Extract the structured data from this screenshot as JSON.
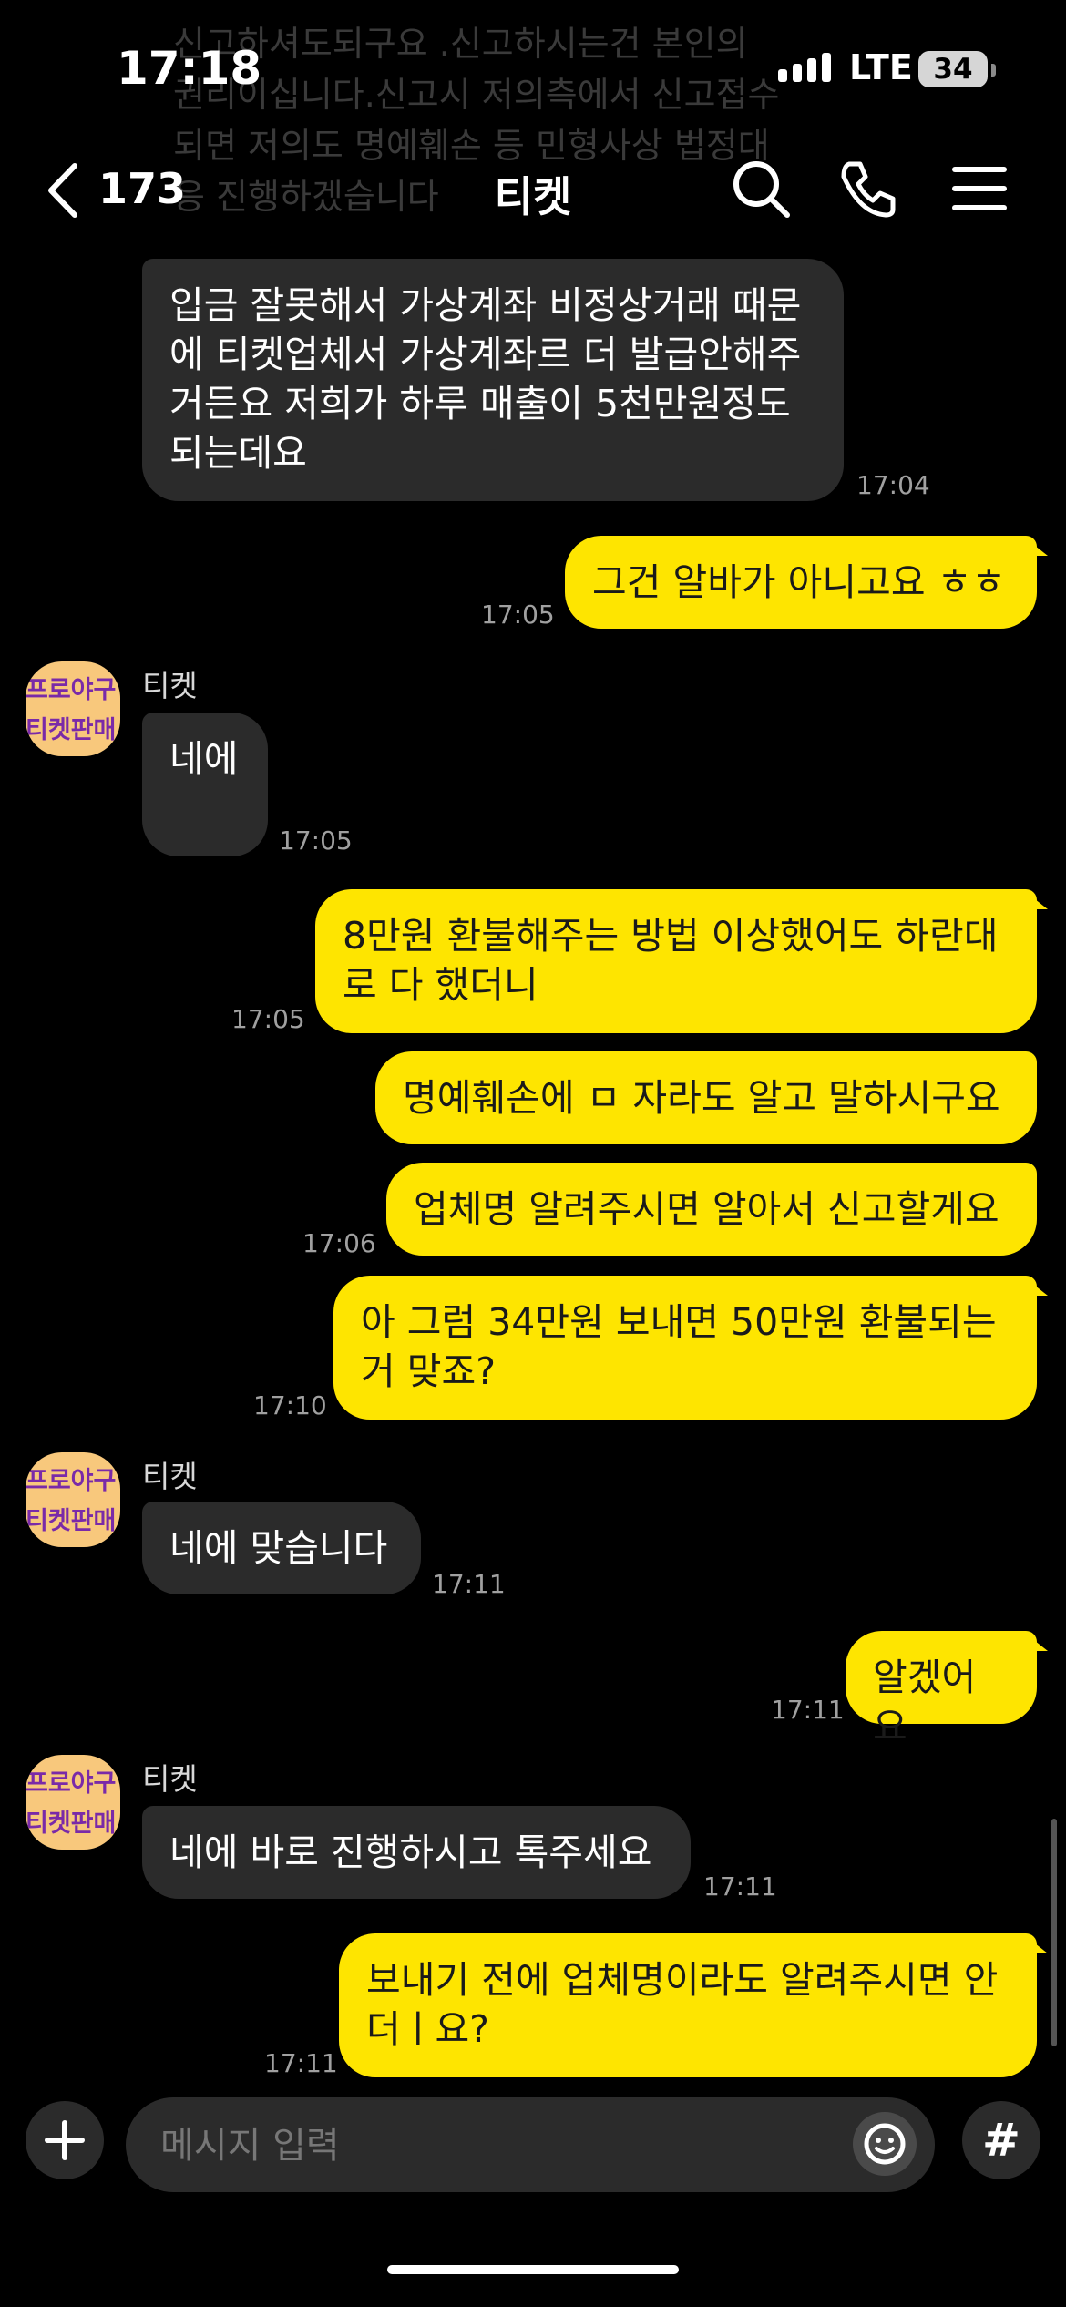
{
  "status_bar": {
    "time": "17:18",
    "network": "LTE",
    "battery": "34"
  },
  "background_text": "신고하셔도되구요 .신고하시는건 본인의\n권리이십니다.신고시 저의측에서 신고접수\n되면 저의도 명예훼손 등 민형사상 법정대\n응 진행하겠습니다",
  "header": {
    "unread_count": "173",
    "title": "티켓"
  },
  "icons": {
    "back": "chevron-left-icon",
    "search": "search-icon",
    "call": "phone-icon",
    "menu": "hamburger-menu-icon",
    "add": "plus-icon",
    "emoji": "emoji-icon"
  },
  "colors": {
    "my_bubble": "#fee500",
    "their_bubble": "#2b2b2b",
    "background": "#000000"
  },
  "avatar_text": "프로야구\n티켓판매",
  "messages": [
    {
      "from": "them",
      "text": "입금 잘못해서 가상계좌 비정상거래 때문\n에 티켓업체서 가상계좌르 더 발급안해주\n거든요 저희가 하루 매출이 5천만원정도\n되는데요",
      "time": "17:04"
    },
    {
      "from": "me",
      "text": "그건 알바가 아니고요 ㅎㅎ",
      "time": "17:05"
    },
    {
      "from": "them",
      "sender": "티켓",
      "text": "네에",
      "time": "17:05"
    },
    {
      "from": "me",
      "text": "8만원 환불해주는 방법 이상했어도 하란대\n로 다 했더니",
      "time": "17:05"
    },
    {
      "from": "me",
      "text": "명예훼손에 ㅁ 자라도 알고 말하시구요",
      "time": ""
    },
    {
      "from": "me",
      "text": "업체명 알려주시면 알아서 신고할게요",
      "time": "17:06"
    },
    {
      "from": "me",
      "text": "아 그럼 34만원 보내면 50만원 환불되는\n거 맞죠?",
      "time": "17:10"
    },
    {
      "from": "them",
      "sender": "티켓",
      "text": "네에 맞습니다",
      "time": "17:11"
    },
    {
      "from": "me",
      "text": "알겠어요",
      "time": "17:11"
    },
    {
      "from": "them",
      "sender": "티켓",
      "text": "네에 바로 진행하시고 톡주세요",
      "time": "17:11"
    },
    {
      "from": "me",
      "text": "보내기 전에 업체명이라도 알려주시면 안\n더ㅣ요?",
      "time": "17:11"
    }
  ],
  "composer": {
    "placeholder": "메시지 입력",
    "hash_label": "#"
  }
}
